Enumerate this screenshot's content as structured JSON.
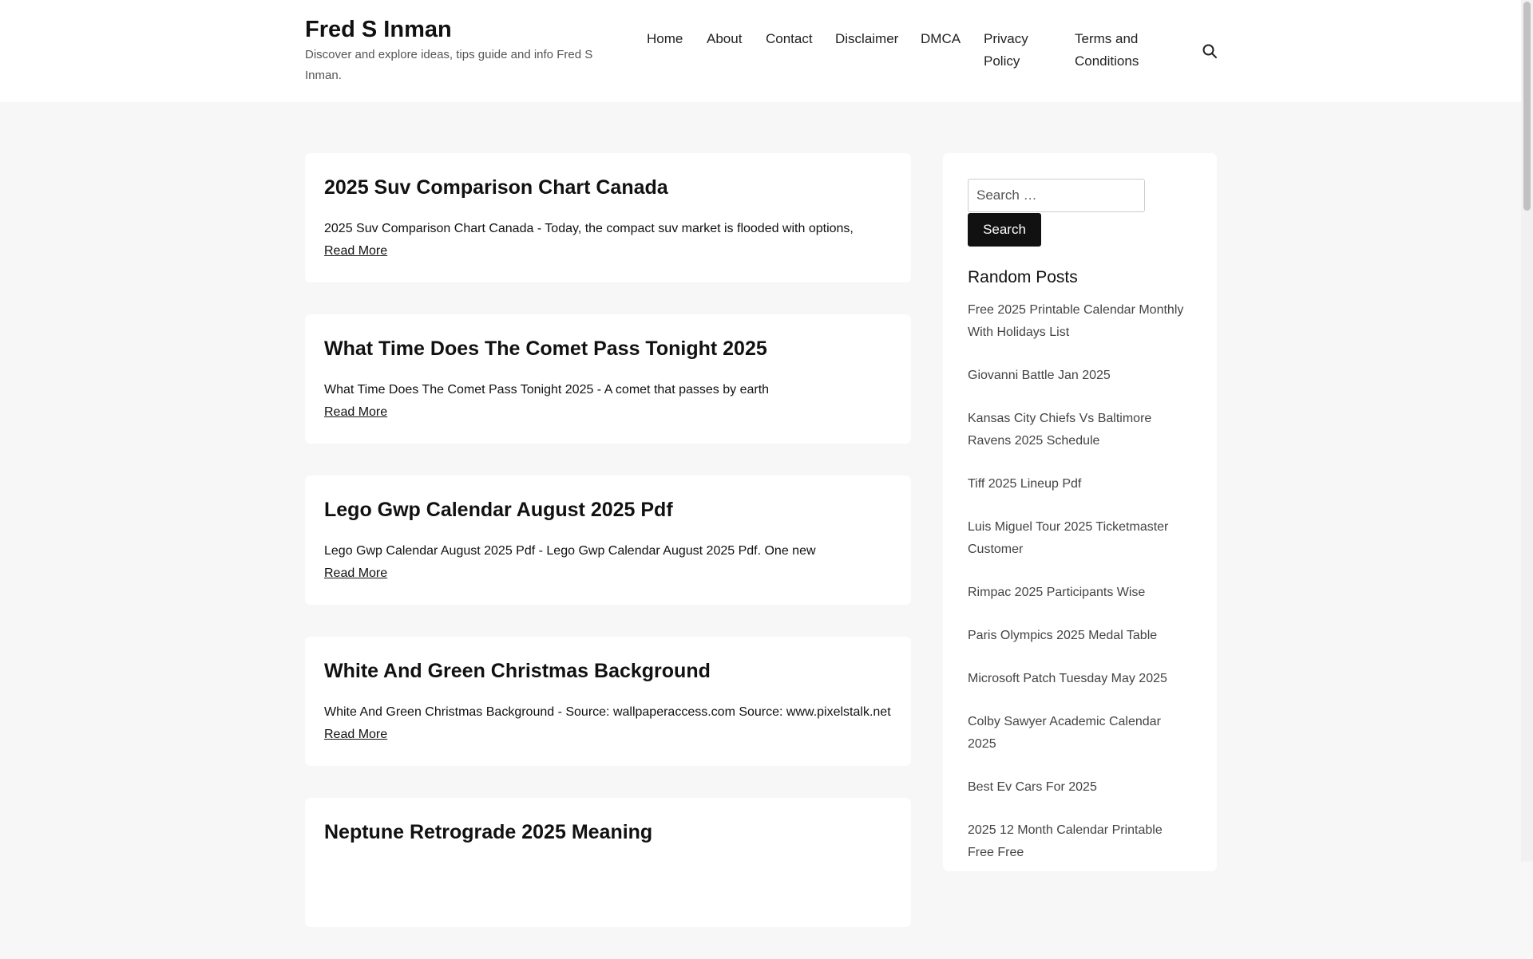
{
  "site": {
    "title": "Fred S Inman",
    "description": "Discover and explore ideas, tips guide and info Fred S Inman."
  },
  "nav": {
    "items": [
      "Home",
      "About",
      "Contact",
      "Disclaimer",
      "DMCA",
      "Privacy Policy",
      "Terms and Conditions"
    ],
    "search_icon": "search-icon"
  },
  "posts": [
    {
      "title": "2025 Suv Comparison Chart Canada",
      "excerpt": "2025 Suv Comparison Chart Canada - Today, the compact suv market is flooded with options,",
      "read_more": "Read More"
    },
    {
      "title": "What Time Does The Comet Pass Tonight 2025",
      "excerpt": "What Time Does The Comet Pass Tonight 2025 - A comet that passes by earth",
      "read_more": "Read More"
    },
    {
      "title": "Lego Gwp Calendar August 2025 Pdf",
      "excerpt": "Lego Gwp Calendar August 2025 Pdf - Lego Gwp Calendar August 2025 Pdf. One new",
      "read_more": "Read More"
    },
    {
      "title": "White And Green Christmas Background",
      "excerpt": "White And Green Christmas Background - Source: wallpaperaccess.com Source: www.pixelstalk.net",
      "read_more": "Read More"
    },
    {
      "title": "Neptune Retrograde 2025 Meaning",
      "excerpt": "",
      "read_more": ""
    }
  ],
  "sidebar": {
    "search": {
      "placeholder": "Search …",
      "button_label": "Search"
    },
    "random_heading": "Random Posts",
    "random_posts": [
      "Free 2025 Printable Calendar Monthly With Holidays List",
      "Giovanni Battle Jan 2025",
      "Kansas City Chiefs Vs Baltimore Ravens 2025 Schedule",
      "Tiff 2025 Lineup Pdf",
      "Luis Miguel Tour 2025 Ticketmaster Customer",
      "Rimpac 2025 Participants Wise",
      "Paris Olympics 2025 Medal Table",
      "Microsoft Patch Tuesday May 2025",
      "Colby Sawyer Academic Calendar 2025",
      "Best Ev Cars For 2025",
      "2025 12 Month Calendar Printable Free Free"
    ]
  },
  "colors": {
    "page_background": "#f7f7f7",
    "card_background": "#ffffff",
    "button_background": "#111111",
    "text": "#111111",
    "muted_text": "#555555"
  }
}
